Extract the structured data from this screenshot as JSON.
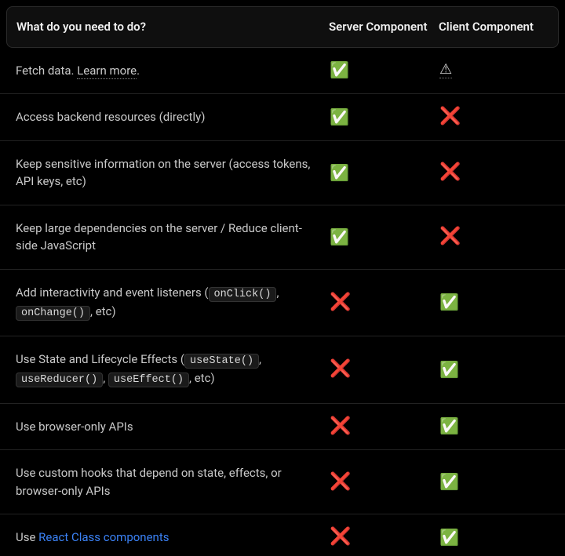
{
  "header": {
    "desc": "What do you need to do?",
    "server": "Server Component",
    "client": "Client Component"
  },
  "marks": {
    "check": "✅",
    "cross": "❌",
    "warn": "⚠"
  },
  "rows": [
    {
      "segments": [
        {
          "type": "text",
          "value": "Fetch data. "
        },
        {
          "type": "link-underline",
          "value": "Learn more"
        },
        {
          "type": "text",
          "value": "."
        }
      ],
      "server": "check",
      "client": "warn"
    },
    {
      "segments": [
        {
          "type": "text",
          "value": "Access backend resources (directly)"
        }
      ],
      "server": "check",
      "client": "cross"
    },
    {
      "segments": [
        {
          "type": "text",
          "value": "Keep sensitive information on the server (access tokens, API keys, etc)"
        }
      ],
      "server": "check",
      "client": "cross"
    },
    {
      "segments": [
        {
          "type": "text",
          "value": "Keep large dependencies on the server / Reduce client-side JavaScript"
        }
      ],
      "server": "check",
      "client": "cross"
    },
    {
      "segments": [
        {
          "type": "text",
          "value": "Add interactivity and event listeners ("
        },
        {
          "type": "code",
          "value": "onClick()"
        },
        {
          "type": "text",
          "value": ", "
        },
        {
          "type": "code",
          "value": "onChange()"
        },
        {
          "type": "text",
          "value": ", etc)"
        }
      ],
      "server": "cross",
      "client": "check"
    },
    {
      "segments": [
        {
          "type": "text",
          "value": "Use State and Lifecycle Effects ("
        },
        {
          "type": "code",
          "value": "useState()"
        },
        {
          "type": "text",
          "value": ", "
        },
        {
          "type": "code",
          "value": "useReducer()"
        },
        {
          "type": "text",
          "value": ", "
        },
        {
          "type": "code",
          "value": "useEffect()"
        },
        {
          "type": "text",
          "value": ", etc)"
        }
      ],
      "server": "cross",
      "client": "check"
    },
    {
      "segments": [
        {
          "type": "text",
          "value": "Use browser-only APIs"
        }
      ],
      "server": "cross",
      "client": "check"
    },
    {
      "segments": [
        {
          "type": "text",
          "value": "Use custom hooks that depend on state, effects, or browser-only APIs"
        }
      ],
      "server": "cross",
      "client": "check"
    },
    {
      "segments": [
        {
          "type": "text",
          "value": "Use "
        },
        {
          "type": "link-blue",
          "value": "React Class components"
        }
      ],
      "server": "cross",
      "client": "check"
    }
  ]
}
